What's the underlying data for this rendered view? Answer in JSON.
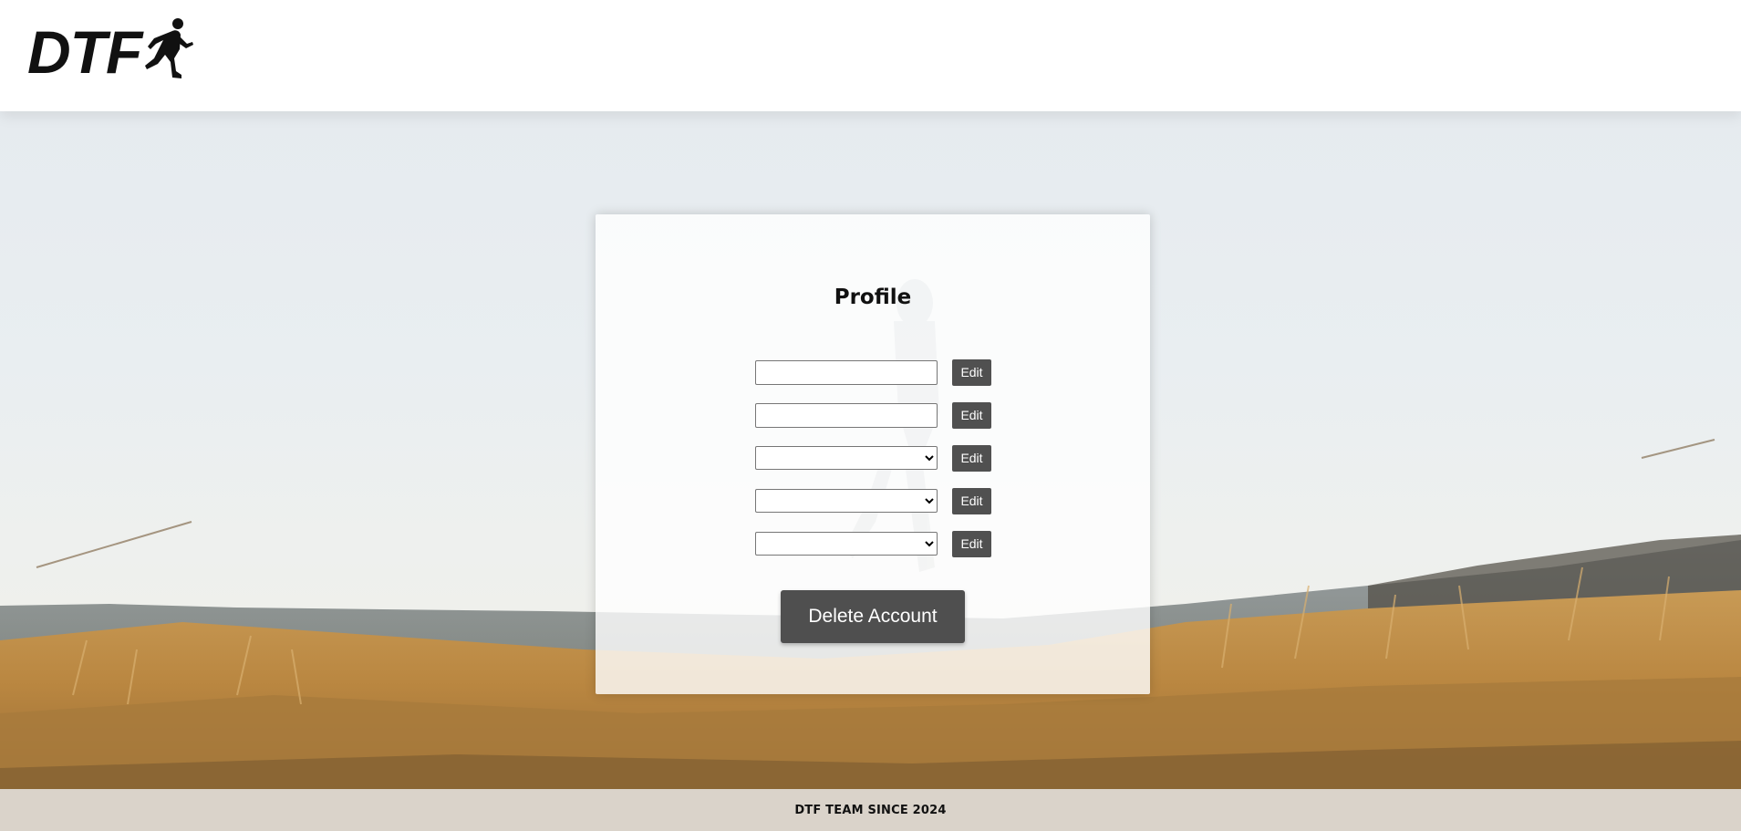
{
  "header": {
    "logo_text": "DTF",
    "logo_icon": "runner-icon"
  },
  "profile": {
    "title": "Profile",
    "fields": [
      {
        "type": "text",
        "value": "",
        "edit_label": "Edit"
      },
      {
        "type": "text",
        "value": "",
        "edit_label": "Edit"
      },
      {
        "type": "select",
        "value": "",
        "edit_label": "Edit"
      },
      {
        "type": "select",
        "value": "",
        "edit_label": "Edit"
      },
      {
        "type": "select",
        "value": "",
        "edit_label": "Edit"
      }
    ],
    "delete_label": "Delete Account"
  },
  "footer": {
    "text": "DTF TEAM SINCE 2024"
  },
  "colors": {
    "button_bg": "#505050",
    "button_text": "#ffffff",
    "header_bg": "#ffffff",
    "footer_bg": "#ebebeb"
  }
}
